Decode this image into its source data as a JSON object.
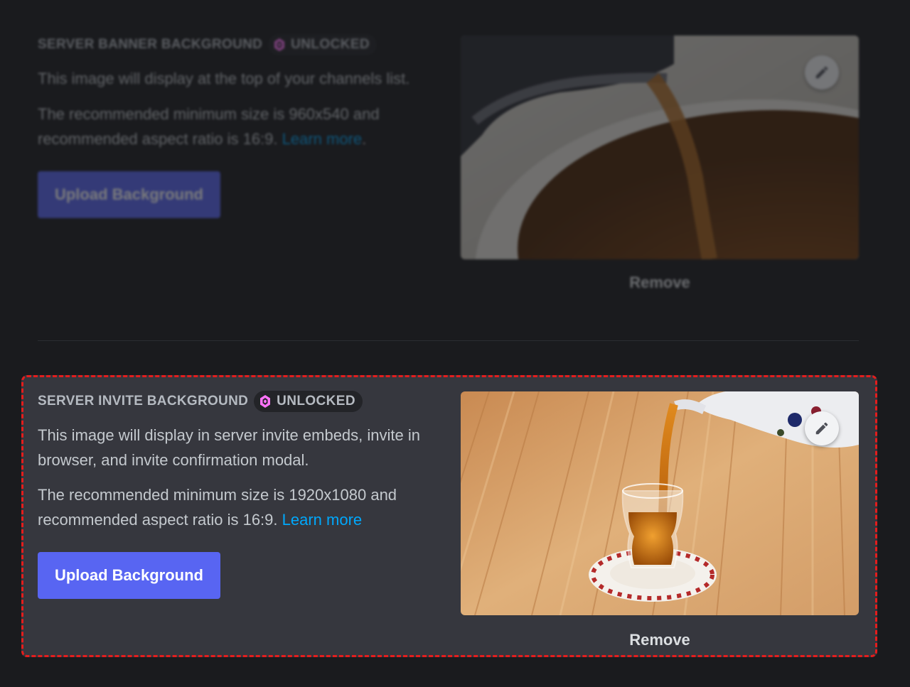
{
  "banner_section": {
    "title": "SERVER BANNER BACKGROUND",
    "badge": "UNLOCKED",
    "description": "This image will display at the top of your channels list.",
    "size_text": "The recommended minimum size is 960x540 and recommended aspect ratio is 16:9.",
    "learn_more": "Learn more",
    "learn_more_suffix": ".",
    "upload_label": "Upload Background",
    "remove_label": "Remove"
  },
  "invite_section": {
    "title": "SERVER INVITE BACKGROUND",
    "badge": "UNLOCKED",
    "description": "This image will display in server invite embeds, invite in browser, and invite confirmation modal.",
    "size_text": "The recommended minimum size is 1920x1080 and recommended aspect ratio is 16:9.",
    "learn_more": "Learn more",
    "upload_label": "Upload Background",
    "remove_label": "Remove"
  },
  "colors": {
    "background": "#1a1b1e",
    "active_panel": "#36373e",
    "highlight_border": "#e41d1d",
    "brand": "#5865f2",
    "link": "#00a8fc",
    "boost_pink": "#ff73fa"
  },
  "icons": {
    "boost": "boost-gem-icon",
    "edit": "pencil-icon"
  }
}
